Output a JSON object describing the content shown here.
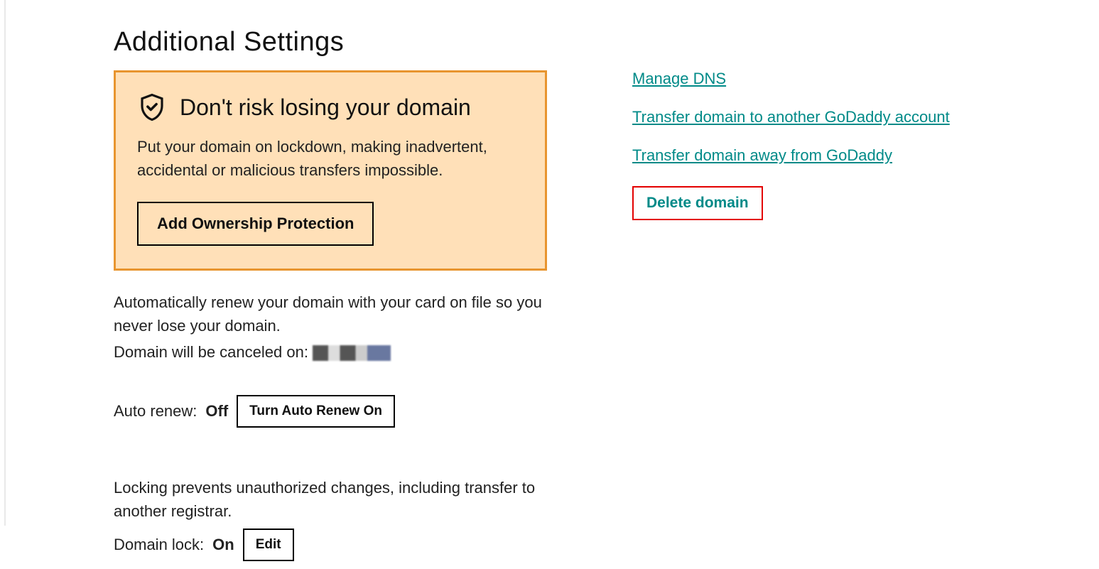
{
  "page": {
    "title": "Additional Settings"
  },
  "warning": {
    "title": "Don't risk losing your domain",
    "text": "Put your domain on lockdown, making inadvertent, accidental or malicious transfers impossible.",
    "button_label": "Add Ownership Protection"
  },
  "autorenew": {
    "description": "Automatically renew your domain with your card on file so you never lose your domain.",
    "cancel_label": "Domain will be canceled on:",
    "status_label": "Auto renew:",
    "status_value": "Off",
    "button_label": "Turn Auto Renew On"
  },
  "domainlock": {
    "description": "Locking prevents unauthorized changes, including transfer to another registrar.",
    "status_label": "Domain lock:",
    "status_value": "On",
    "button_label": "Edit"
  },
  "links": {
    "manage_dns": "Manage DNS",
    "transfer_to_account": "Transfer domain to another GoDaddy account",
    "transfer_away": "Transfer domain away from GoDaddy",
    "delete_domain": "Delete domain"
  }
}
